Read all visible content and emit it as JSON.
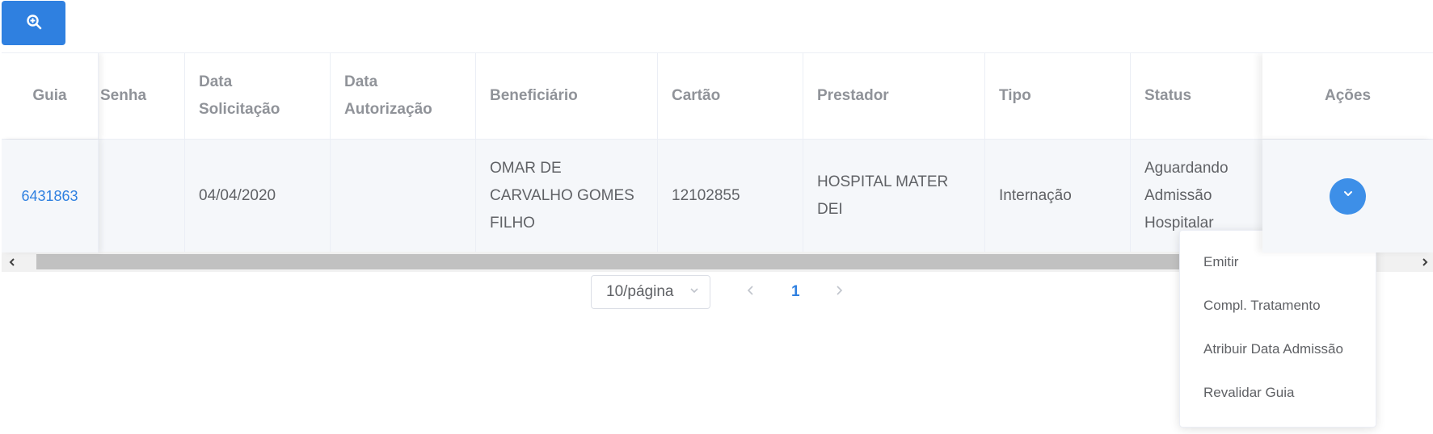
{
  "search_button": {
    "icon": "zoom-in-icon"
  },
  "table": {
    "headers": {
      "guia": "Guia",
      "senha": "Senha",
      "data_solicitacao": "Data Solicitação",
      "data_autorizacao": "Data Autorização",
      "beneficiario": "Beneficiário",
      "cartao": "Cartão",
      "prestador": "Prestador",
      "tipo": "Tipo",
      "status": "Status",
      "acoes": "Ações"
    },
    "rows": [
      {
        "guia": "6431863",
        "senha": "",
        "data_solicitacao": "04/04/2020",
        "data_autorizacao": "",
        "beneficiario": "OMAR DE CARVALHO GOMES FILHO",
        "cartao": "12102855",
        "prestador": "HOSPITAL MATER DEI",
        "tipo": "Internação",
        "status": "Aguardando Admissão Hospitalar"
      }
    ]
  },
  "pagination": {
    "page_size": "10/página",
    "current_page": "1"
  },
  "actions_menu": {
    "items": [
      "Emitir",
      "Compl. Tratamento",
      "Atribuir Data Admissão",
      "Revalidar Guia"
    ]
  },
  "colors": {
    "primary": "#2f80e0",
    "header_text": "#909399",
    "body_text": "#606266",
    "row_bg": "#f5f7fa"
  }
}
